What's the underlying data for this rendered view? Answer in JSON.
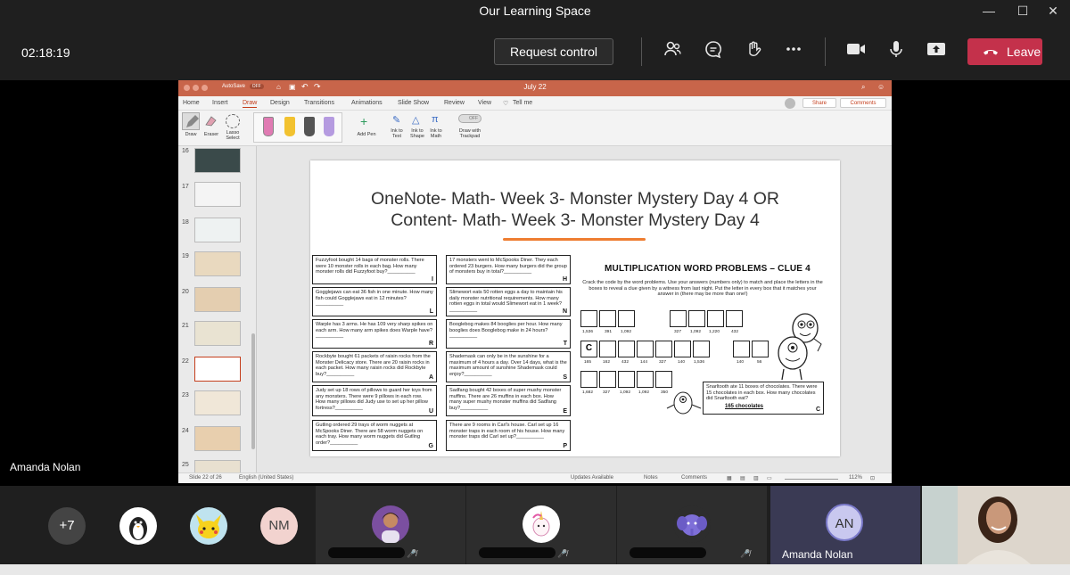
{
  "window": {
    "title": "Our Learning Space",
    "controls": [
      "—",
      "☐",
      "✕"
    ]
  },
  "meeting": {
    "timer": "02:18:19",
    "request_control": "Request control",
    "leave": "Leave",
    "presenter": "Amanda Nolan",
    "icons": [
      "participants-icon",
      "chat-icon",
      "raise-hand-icon",
      "more-icon",
      "camera-icon",
      "mic-icon",
      "share-icon"
    ]
  },
  "ppt": {
    "filename": "July 22",
    "autosave": "AutoSave",
    "autosave_state": "OFF",
    "tabs": [
      "Home",
      "Insert",
      "Draw",
      "Design",
      "Transitions",
      "Animations",
      "Slide Show",
      "Review",
      "View",
      "Tell me"
    ],
    "active_tab": "Draw",
    "share": "Share",
    "comments": "Comments",
    "ribbon": {
      "draw": "Draw",
      "eraser": "Eraser",
      "lasso": "Lasso Select",
      "add_pen": "Add Pen",
      "ink_to_text": "Ink to Text",
      "ink_to_shape": "Ink to Shape",
      "ink_to_math": "Ink to Math",
      "trackpad_toggle": "OFF",
      "draw_trackpad": "Draw with Trackpad"
    },
    "thumbnails": [
      "16",
      "17",
      "18",
      "19",
      "20",
      "21",
      "22",
      "23",
      "24",
      "25"
    ],
    "selected_thumbnail": "22",
    "status": {
      "slide": "Slide 22 of 26",
      "language": "English (United States)",
      "updates": "Updates Available",
      "notes": "Notes",
      "comments": "Comments",
      "zoom": "112%"
    }
  },
  "slide": {
    "title_line1": "OneNote- Math- Week 3- Monster Mystery Day 4 OR",
    "title_line2": "Content- Math- Week 3- Monster Mystery Day 4",
    "problems_left": [
      {
        "text": "Fuzzyfoot bought 14 bags of monster rolls. There were 10 monster rolls in each bag. How many monster rolls did Fuzzyfoot buy?__________",
        "letter": "I"
      },
      {
        "text": "Gogglejaws can eat 36 fish in one minute. How many fish could Gogglejaws eat in 12 minutes?__________",
        "letter": "L"
      },
      {
        "text": "Warple has 3 arms. He has 109 very sharp spikes on each arm. How many arm spikes does Warple have?__________",
        "letter": "R"
      },
      {
        "text": "Rockbyte bought 61 packets of raisin rocks from the Monster Delicacy store. There are 20 raisin rocks in each packet. How many raisin rocks did Rockbyte buy?__________",
        "letter": "A"
      },
      {
        "text": "Judy set up 18 rows of pillows to guard her toys from any monsters. There were 9 pillows in each row. How many pillows did Judy use to set up her pillow fortress?__________",
        "letter": "U"
      },
      {
        "text": "Gutling ordered 29 trays of worm nuggets at McSpooks Diner. There are 58 worm nuggets on each tray. How many worm nuggets did Gutling order?__________",
        "letter": "G"
      }
    ],
    "problems_mid": [
      {
        "text": "17 monsters went to McSpooks Diner. They each ordered 23 burgers. How many burgers did the group of monsters buy in total?__________",
        "letter": "H"
      },
      {
        "text": "Slimewort eats 50 rotten eggs a day to maintain his daily monster nutritional requirements. How many rotten eggs in total would Slimewort eat in 1 week?__________",
        "letter": "N"
      },
      {
        "text": "Booglebog makes 84 booglies per hour. How many booglies does Booglebog make in 24 hours?__________",
        "letter": "T"
      },
      {
        "text": "Shademask can only be in the sunshine for a maximum of 4 hours a day. Over 14 days, what is the maximum amount of sunshine Shademask could enjoy?__________",
        "letter": "S"
      },
      {
        "text": "Sadfang bought 42 boxes of super mushy monster muffins. There are 26 muffins in each box. How many super mushy monster muffins did Sadfang buy?__________",
        "letter": "E"
      },
      {
        "text": "There are 9 rooms in Carl's house. Carl set up 16 monster traps in each room of his house. How many monster traps did Carl set up?__________",
        "letter": "P"
      }
    ],
    "clue_title": "MULTIPLICATION WORD PROBLEMS – CLUE 4",
    "instructions": "Crack the code by the word problems. Use your answers (numbers only) to match and place the letters in the boxes to reveal a clue given by a witness from last night. Put the letter in every box that it matches your answer in (there may be more than one!)",
    "code_row1_a": [
      "1,536",
      "391",
      "1,092"
    ],
    "code_row1_b": [
      "327",
      "1,092",
      "1,220",
      "432"
    ],
    "code_row2_a": [
      "165",
      "162",
      "432",
      "144",
      "327",
      "140",
      "1,536"
    ],
    "code_row2_b": [
      "140",
      "56"
    ],
    "code_row3": [
      "1,682",
      "327",
      "1,092",
      "1,092",
      "350"
    ],
    "filled_letter": "C",
    "example_text": "Snarltooth ate 11 boxes of chocolates. There were 15 chocolates in each box. How many chocolates did Snarltooth eat?",
    "example_answer": "165 chocolates",
    "example_letter": "C"
  },
  "participants": {
    "overflow": "+7",
    "initials_nm": "NM",
    "initials_an": "AN",
    "an_name": "Amanda Nolan",
    "colors": {
      "nm_bg": "#f2d3cf",
      "an_bg": "#c9c8ef",
      "leave_red": "#c4314b"
    }
  }
}
